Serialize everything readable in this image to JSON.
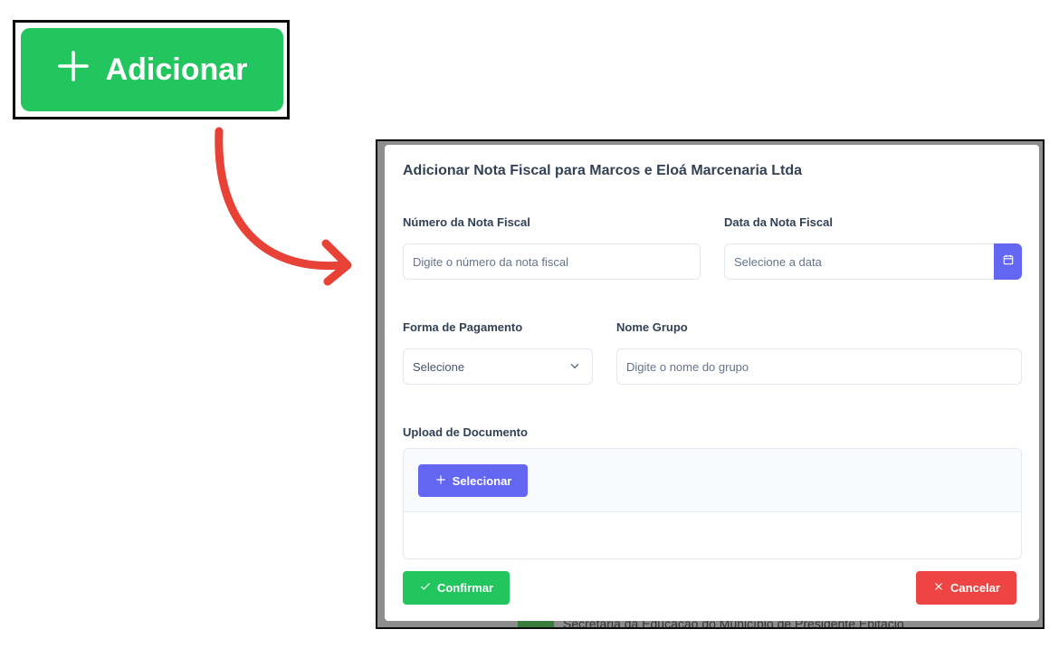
{
  "callout": {
    "add_label": "Adicionar"
  },
  "background": {
    "top_text": "",
    "footer_text": "Secretaria da Educação do Município de Presidente Epitácio"
  },
  "modal": {
    "title": "Adicionar Nota Fiscal para Marcos e Eloá Marcenaria Ltda",
    "invoice_number": {
      "label": "Número da Nota Fiscal",
      "placeholder": "Digite o número da nota fiscal",
      "value": ""
    },
    "invoice_date": {
      "label": "Data da Nota Fiscal",
      "placeholder": "Selecione a data",
      "value": ""
    },
    "payment_method": {
      "label": "Forma de Pagamento",
      "selected": "Selecione"
    },
    "group_name": {
      "label": "Nome Grupo",
      "placeholder": "Digite o nome do grupo",
      "value": ""
    },
    "upload": {
      "label": "Upload de Documento",
      "select_label": "Selecionar"
    },
    "confirm_label": "Confirmar",
    "cancel_label": "Cancelar"
  },
  "colors": {
    "green": "#22c55e",
    "indigo": "#6366f1",
    "red": "#ef4444",
    "arrow": "#e84135"
  },
  "icons": {
    "add": "plus-icon",
    "calendar": "calendar-icon",
    "dropdown": "chevron-down-icon",
    "confirm": "check-icon",
    "cancel": "close-icon"
  }
}
